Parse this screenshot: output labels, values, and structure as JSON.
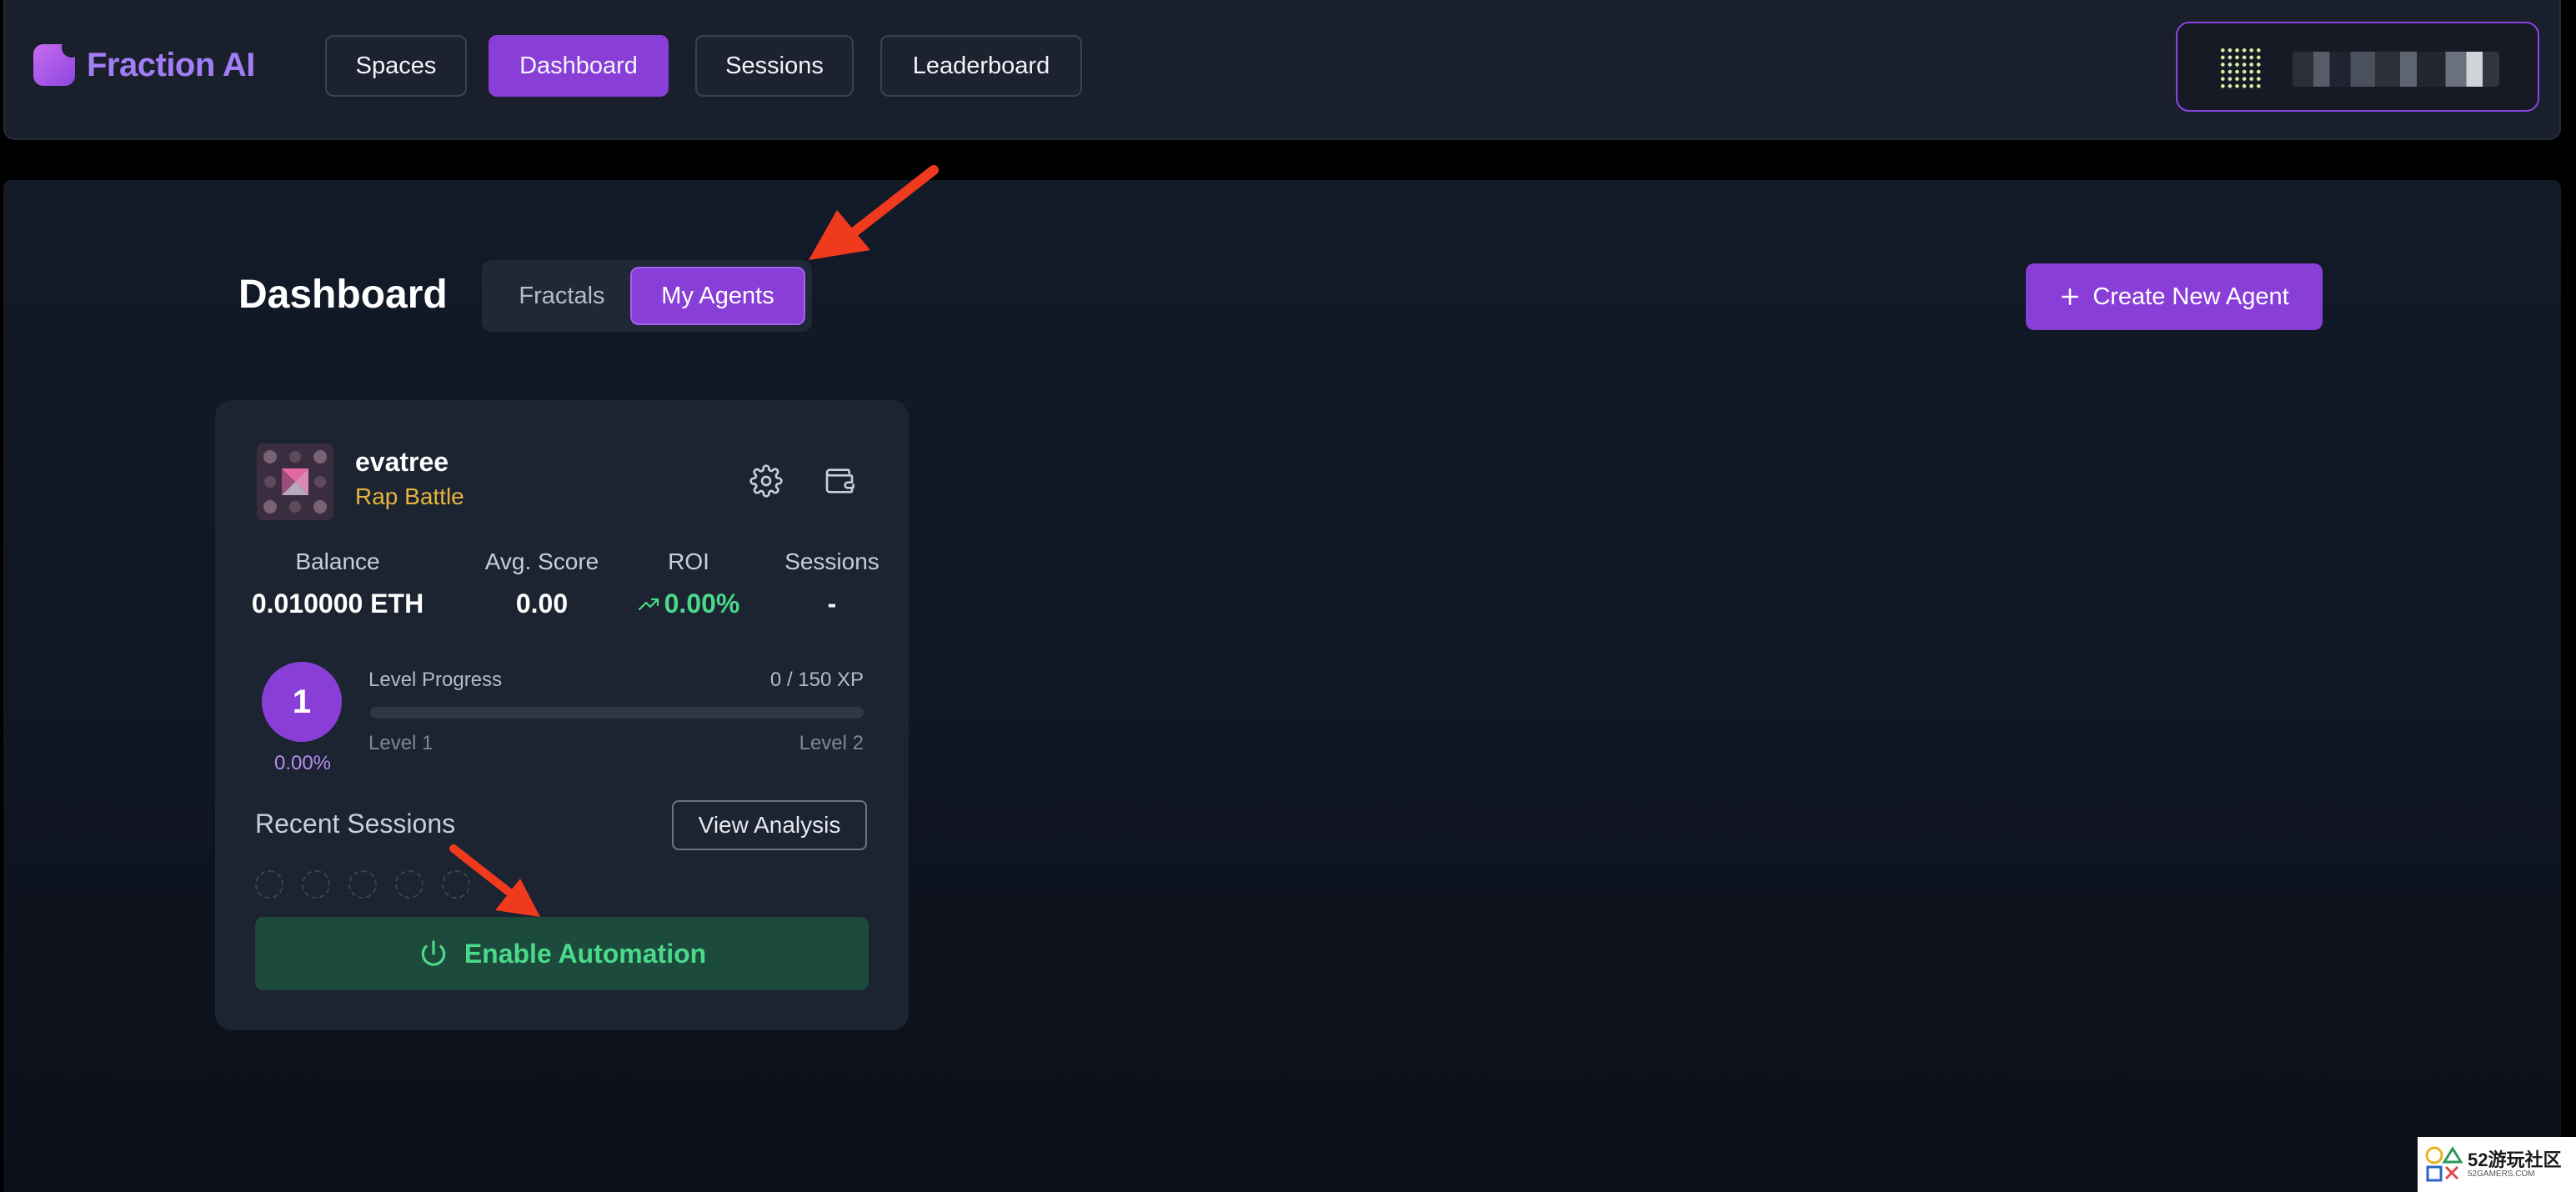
{
  "app": {
    "name": "Fraction AI"
  },
  "nav": {
    "items": [
      {
        "label": "Spaces"
      },
      {
        "label": "Dashboard",
        "active": true
      },
      {
        "label": "Sessions"
      },
      {
        "label": "Leaderboard"
      }
    ]
  },
  "page": {
    "title": "Dashboard",
    "tabs": [
      {
        "label": "Fractals"
      },
      {
        "label": "My Agents",
        "active": true
      }
    ],
    "create_button": "Create New Agent"
  },
  "agent": {
    "name": "evatree",
    "space": "Rap Battle",
    "stats": [
      {
        "label": "Balance",
        "value": "0.010000 ETH"
      },
      {
        "label": "Avg. Score",
        "value": "0.00"
      },
      {
        "label": "ROI",
        "value": "0.00%"
      },
      {
        "label": "Sessions",
        "value": "-"
      }
    ],
    "level": {
      "current": "1",
      "percent": "0.00%",
      "progress_label": "Level Progress",
      "xp": "0 / 150 XP",
      "progress_fraction": 0,
      "from": "Level 1",
      "to": "Level 2"
    },
    "recent_sessions_label": "Recent Sessions",
    "view_analysis": "View Analysis",
    "automation_button": "Enable Automation"
  },
  "icons": {
    "settings": "gear-icon",
    "wallet": "wallet-icon",
    "plus": "plus-icon",
    "power": "power-icon",
    "trend": "trend-up-icon"
  },
  "colors": {
    "accent": "#8a3ed8",
    "space": "#e8b43c",
    "positive": "#4ad98a",
    "annotation_arrow": "#f03a1e"
  },
  "watermark": {
    "text": "52游玩社区",
    "sub": "52GAMERS.COM"
  }
}
